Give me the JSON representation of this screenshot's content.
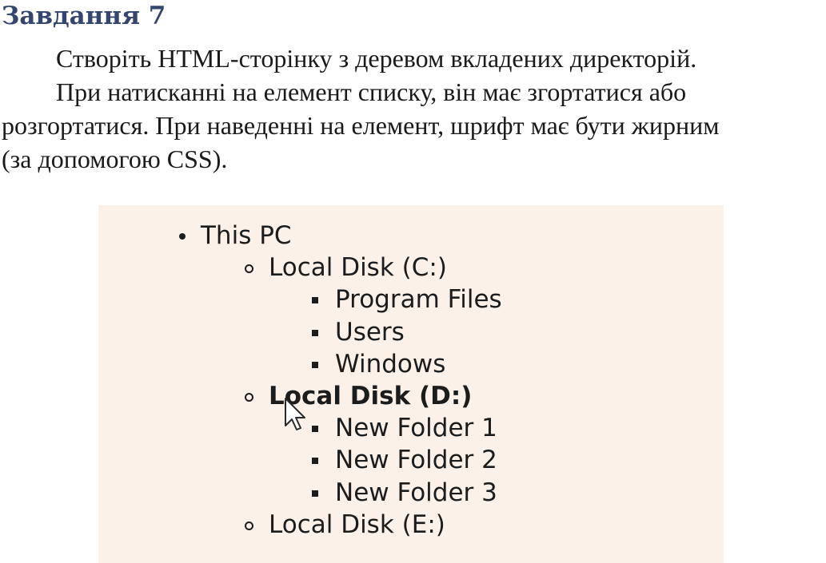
{
  "task": {
    "title": "Завдання 7",
    "paragraph1": "Створіть HTML-сторінку з деревом вкладених директорій.",
    "paragraph2_line1": "При натисканні на елемент списку, він має згортатися або",
    "paragraph2_line2": "розгортатися. При наведенні на елемент, шрифт має бути жирним",
    "paragraph2_line3": "(за допомогою CSS)."
  },
  "tree": {
    "root": {
      "label": "This PC"
    },
    "disk_c": {
      "label": "Local Disk (C:)"
    },
    "disk_c_items": [
      "Program Files",
      "Users",
      "Windows"
    ],
    "disk_d": {
      "label": "Local Disk (D:)",
      "hovered": true
    },
    "disk_d_items": [
      "New Folder 1",
      "New Folder 2",
      "New Folder 3"
    ],
    "disk_e": {
      "label": "Local Disk (E:)"
    }
  },
  "colors": {
    "title": "#34456e",
    "panel_background": "#fbf1e8",
    "text": "#1c1c1c"
  },
  "icons": {
    "cursor": "arrow-cursor-icon"
  }
}
